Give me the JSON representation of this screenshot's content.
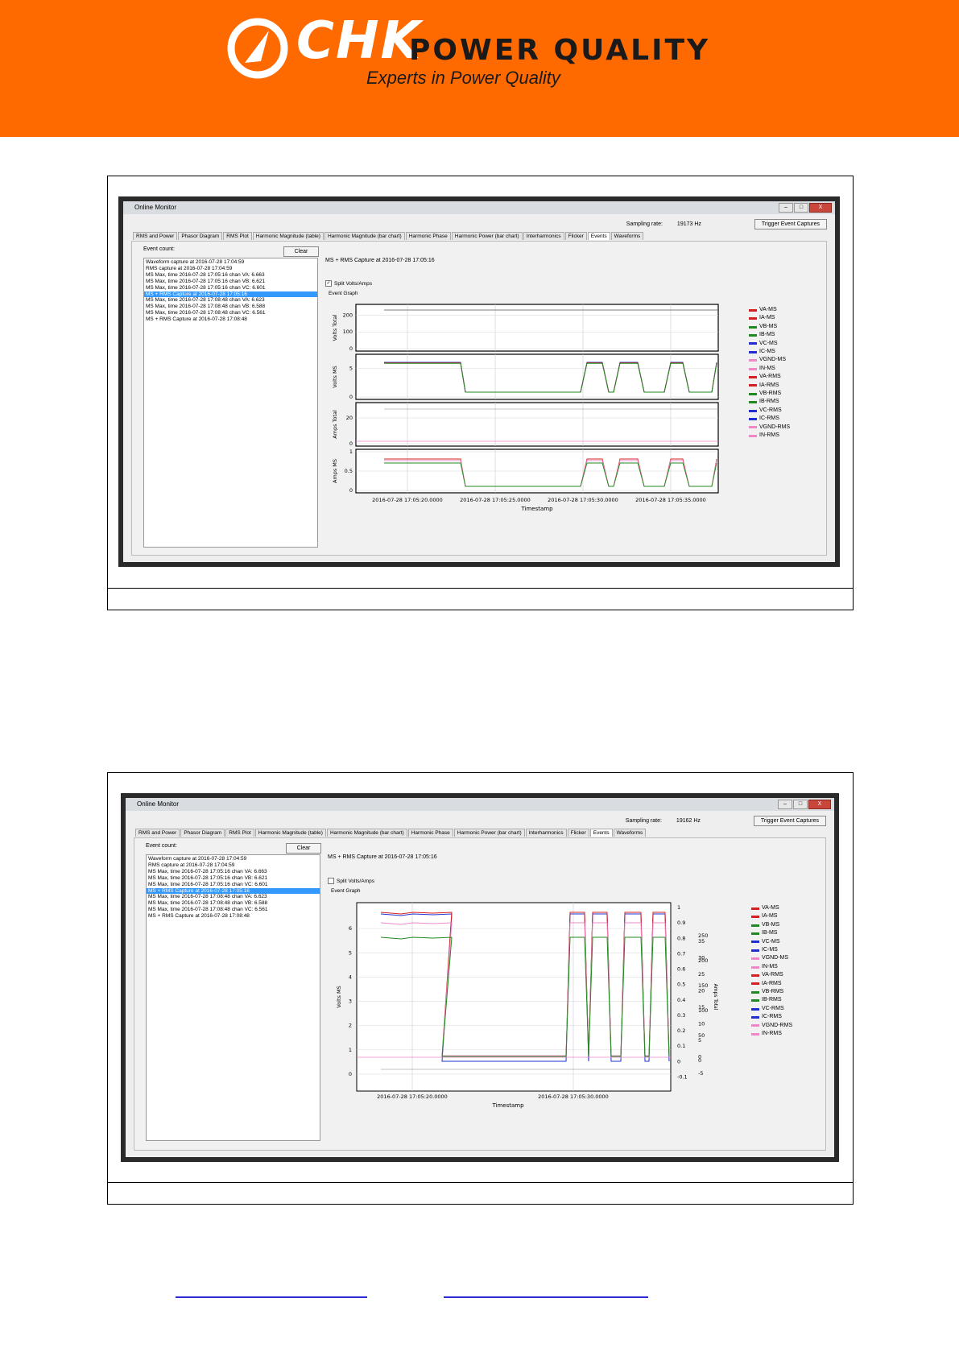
{
  "brand": {
    "name_part1": "CHK",
    "name_part2": "POWER QUALITY",
    "tagline": "Experts in Power Quality",
    "orange": "#ff6a00"
  },
  "screens": [
    {
      "window_title": "Online Monitor",
      "sampling_label": "Sampling rate:",
      "sampling_value": "19173 Hz",
      "trigger_button": "Trigger Event Captures",
      "tabs": [
        "RMS and Power",
        "Phasor Diagram",
        "RMS Plot",
        "Harmonic Magnitude (table)",
        "Harmonic Magnitude (bar chart)",
        "Harmonic Phase",
        "Harmonic Power (bar chart)",
        "Interharmonics",
        "Flicker",
        "Events",
        "Waveforms"
      ],
      "active_tab": "Events",
      "event_count_label": "Event count:",
      "clear_button": "Clear",
      "events": [
        "Waveform capture at 2016-07-28 17:04:59",
        "RMS capture at 2016-07-28 17:04:59",
        "MS Max, time 2016-07-28 17:05:16 chan VA: 6.663",
        "MS Max, time 2016-07-28 17:05:16 chan VB: 6.621",
        "MS Max, time 2016-07-28 17:05:16 chan VC: 6.601",
        "MS + RMS Capture at 2016-07-28 17:05:16",
        "MS Max, time 2016-07-28 17:08:48 chan VA: 6.623",
        "MS Max, time 2016-07-28 17:08:48 chan VB: 6.588",
        "MS Max, time 2016-07-28 17:08:48 chan VC: 6.561",
        "MS + RMS Capture at 2016-07-28 17:08:48"
      ],
      "selected_event": 5,
      "capture_title": "MS + RMS Capture at 2016-07-28 17:05:16",
      "split_label": "Split Volts/Amps",
      "split_checked": true,
      "graph_title": "Event Graph"
    },
    {
      "window_title": "Online Monitor",
      "sampling_label": "Sampling rate:",
      "sampling_value": "19162 Hz",
      "trigger_button": "Trigger Event Captures",
      "tabs": [
        "RMS and Power",
        "Phasor Diagram",
        "RMS Plot",
        "Harmonic Magnitude (table)",
        "Harmonic Magnitude (bar chart)",
        "Harmonic Phase",
        "Harmonic Power (bar chart)",
        "Interharmonics",
        "Flicker",
        "Events",
        "Waveforms"
      ],
      "active_tab": "Events",
      "event_count_label": "Event count:",
      "clear_button": "Clear",
      "events": [
        "Waveform capture at 2016-07-28 17:04:59",
        "RMS capture at 2016-07-28 17:04:59",
        "MS Max, time 2016-07-28 17:05:16 chan VA: 6.663",
        "MS Max, time 2016-07-28 17:05:16 chan VB: 6.621",
        "MS Max, time 2016-07-28 17:05:16 chan VC: 6.601",
        "MS + RMS Capture at 2016-07-28 17:05:16",
        "MS Max, time 2016-07-28 17:08:48 chan VA: 6.623",
        "MS Max, time 2016-07-28 17:08:48 chan VB: 6.588",
        "MS Max, time 2016-07-28 17:08:48 chan VC: 6.561",
        "MS + RMS Capture at 2016-07-28 17:08:48"
      ],
      "selected_event": 5,
      "capture_title": "MS + RMS Capture at 2016-07-28 17:05:16",
      "split_label": "Split Volts/Amps",
      "split_checked": false,
      "graph_title": "Event Graph"
    }
  ],
  "legend": [
    {
      "label": "VA-MS",
      "color": "#d62020"
    },
    {
      "label": "IA-MS",
      "color": "#d62020"
    },
    {
      "label": "VB-MS",
      "color": "#1f8a1f"
    },
    {
      "label": "IB-MS",
      "color": "#1f8a1f"
    },
    {
      "label": "VC-MS",
      "color": "#1f2fd0"
    },
    {
      "label": "IC-MS",
      "color": "#1f2fd0"
    },
    {
      "label": "VGND-MS",
      "color": "#ee88c8"
    },
    {
      "label": "IN-MS",
      "color": "#ee88c8"
    },
    {
      "label": "VA-RMS",
      "color": "#d62020"
    },
    {
      "label": "IA-RMS",
      "color": "#d62020"
    },
    {
      "label": "VB-RMS",
      "color": "#1f8a1f"
    },
    {
      "label": "IB-RMS",
      "color": "#1f8a1f"
    },
    {
      "label": "VC-RMS",
      "color": "#1f2fd0"
    },
    {
      "label": "IC-RMS",
      "color": "#1f2fd0"
    },
    {
      "label": "VGND-RMS",
      "color": "#ee88c8"
    },
    {
      "label": "IN-RMS",
      "color": "#ee88c8"
    }
  ],
  "chart_data": [
    {
      "type": "line",
      "title": "",
      "xlabel": "Timestamp",
      "x_ticks": [
        "2016-07-28 17:05:20.0000",
        "2016-07-28 17:05:25.0000",
        "2016-07-28 17:05:30.0000",
        "2016-07-28 17:05:35.0000"
      ],
      "panels": [
        {
          "ylabel": "Volts Total",
          "yticks": [
            "0",
            "100",
            "200"
          ],
          "ylim": [
            0,
            250
          ]
        },
        {
          "ylabel": "Volts MS",
          "yticks": [
            "0",
            "5"
          ],
          "ylim": [
            0,
            7
          ]
        },
        {
          "ylabel": "Amps Total",
          "yticks": [
            "0",
            "20"
          ],
          "ylim": [
            0,
            30
          ]
        },
        {
          "ylabel": "Amps MS",
          "yticks": [
            "0",
            "0.5",
            "1"
          ],
          "ylim": [
            0,
            1
          ]
        }
      ]
    },
    {
      "type": "line",
      "title": "",
      "xlabel": "Timestamp",
      "x_ticks": [
        "2016-07-28 17:05:20.0000",
        "2016-07-28 17:05:30.0000"
      ],
      "left_axis": {
        "label": "Volts MS",
        "ticks": [
          "0",
          "1",
          "2",
          "3",
          "4",
          "5",
          "6"
        ],
        "ylim": [
          -0.3,
          6.8
        ]
      },
      "right_axis_1": {
        "label": "",
        "ticks": [
          "-0.1",
          "0",
          "0.1",
          "0.2",
          "0.3",
          "0.4",
          "0.5",
          "0.6",
          "0.7",
          "0.8",
          "0.9",
          "1"
        ],
        "ylim": [
          -0.15,
          1.0
        ]
      },
      "right_axis_2": {
        "label": "Amps Total",
        "ticks": [
          "-5",
          "0",
          "5",
          "10",
          "15",
          "20",
          "25",
          "30",
          "35"
        ]
      },
      "right_axis_3": {
        "label": "",
        "ticks": [
          "0",
          "50",
          "100",
          "150",
          "200",
          "250"
        ]
      }
    }
  ]
}
